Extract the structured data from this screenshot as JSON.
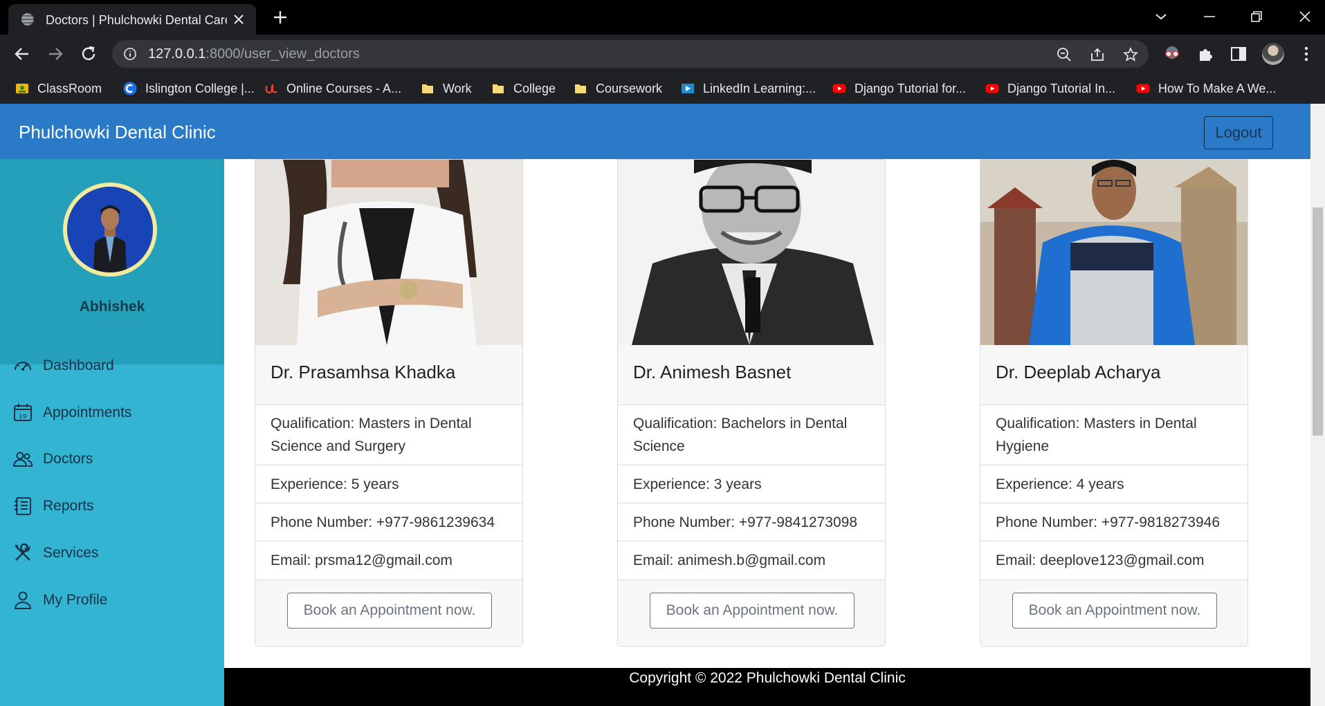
{
  "browser": {
    "tab_title": "Doctors | Phulchowki Dental Care",
    "url_host": "127.0.0.1",
    "url_rest": ":8000/user_view_doctors",
    "bookmarks": [
      {
        "label": "ClassRoom",
        "icon": "classroom-icon"
      },
      {
        "label": "Islington College |...",
        "icon": "college-icon"
      },
      {
        "label": "Online Courses - A...",
        "icon": "udemy-icon"
      },
      {
        "label": "Work",
        "icon": "folder-icon"
      },
      {
        "label": "College",
        "icon": "folder-icon"
      },
      {
        "label": "Coursework",
        "icon": "folder-icon"
      },
      {
        "label": "LinkedIn Learning:...",
        "icon": "linkedin-icon"
      },
      {
        "label": "Django Tutorial for...",
        "icon": "youtube-icon"
      },
      {
        "label": "Django Tutorial In...",
        "icon": "youtube-icon"
      },
      {
        "label": "How To Make A We...",
        "icon": "youtube-icon"
      }
    ]
  },
  "app": {
    "brand": "Phulchowki Dental Clinic",
    "logout_label": "Logout",
    "brand_color": "#2a7ac8"
  },
  "sidebar": {
    "username": "Abhishek",
    "items": [
      {
        "label": "Dashboard",
        "icon": "dashboard-icon"
      },
      {
        "label": "Appointments",
        "icon": "calendar-icon"
      },
      {
        "label": "Doctors",
        "icon": "people-icon"
      },
      {
        "label": "Reports",
        "icon": "report-icon"
      },
      {
        "label": "Services",
        "icon": "tools-icon"
      },
      {
        "label": "My Profile",
        "icon": "person-icon"
      }
    ]
  },
  "doctors": [
    {
      "name": "Dr. Prasamhsa Khadka",
      "qualification": "Qualification: Masters in Dental Science and Surgery",
      "experience": "Experience: 5 years",
      "phone": "Phone Number: +977-9861239634",
      "email": "Email: prsma12@gmail.com",
      "book_label": "Book an Appointment now."
    },
    {
      "name": "Dr. Animesh Basnet",
      "qualification": "Qualification: Bachelors in Dental Science",
      "experience": "Experience: 3 years",
      "phone": "Phone Number: +977-9841273098",
      "email": "Email: animesh.b@gmail.com",
      "book_label": "Book an Appointment now."
    },
    {
      "name": "Dr. Deeplab Acharya",
      "qualification": "Qualification: Masters in Dental Hygiene",
      "experience": "Experience: 4 years",
      "phone": "Phone Number: +977-9818273946",
      "email": "Email: deeplove123@gmail.com",
      "book_label": "Book an Appointment now."
    }
  ],
  "footer": {
    "text": "Copyright © 2022 Phulchowki Dental Clinic"
  }
}
